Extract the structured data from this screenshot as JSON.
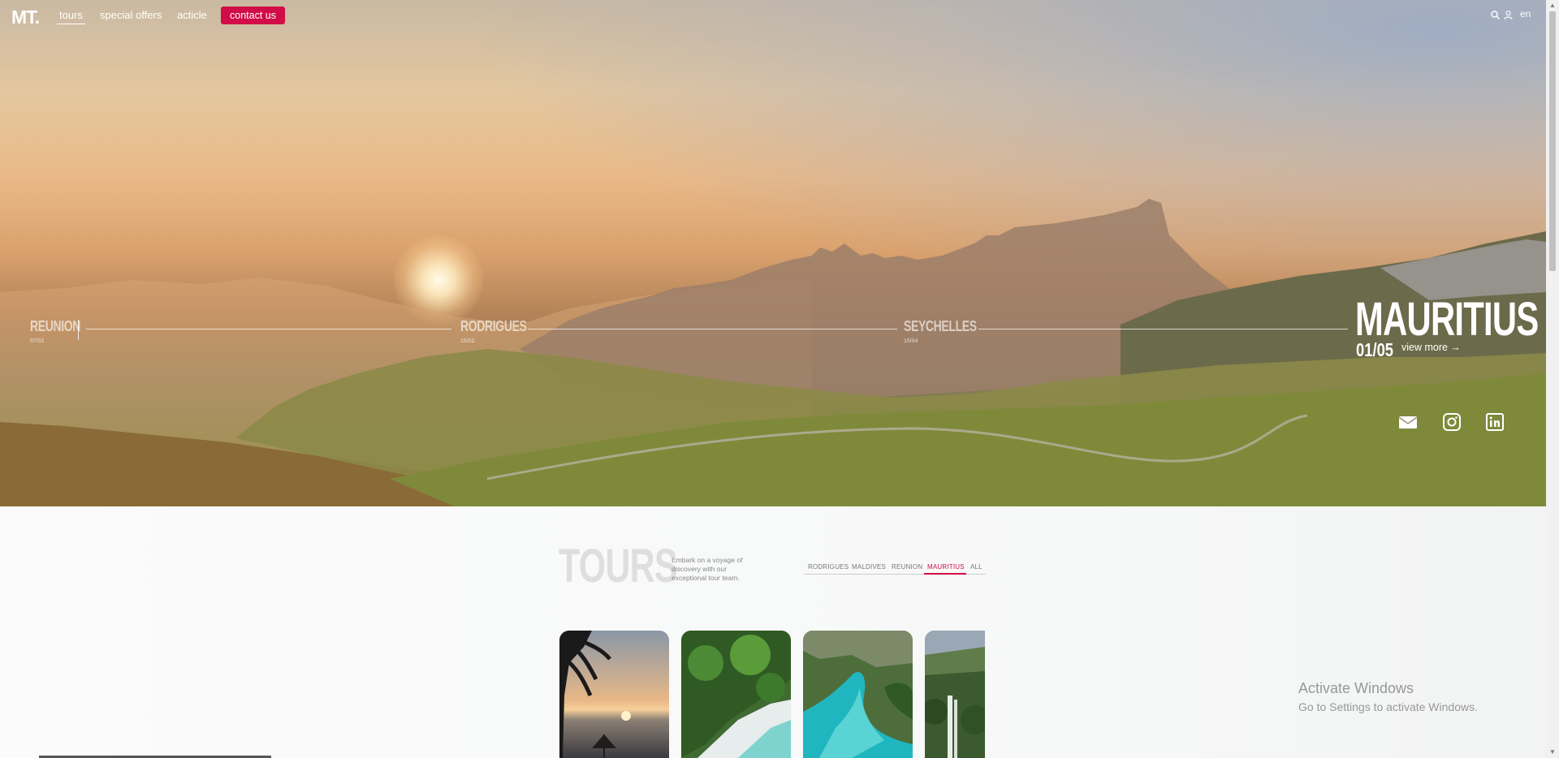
{
  "header": {
    "logo": "MT.",
    "nav": [
      {
        "label": "tours",
        "active": true
      },
      {
        "label": "special offers",
        "active": false
      },
      {
        "label": "acticle",
        "active": false
      }
    ],
    "contact_label": "contact us",
    "lang": "en",
    "icons": [
      "search-icon",
      "user-icon"
    ]
  },
  "hero": {
    "destinations": [
      {
        "name": "REUNION",
        "num": "07/01"
      },
      {
        "name": "RODRIGUES",
        "num": "15/02"
      },
      {
        "name": "SEYCHELLES",
        "num": "15/04"
      }
    ],
    "current": {
      "name": "MAURITIUS",
      "counter": "01/05",
      "view_more": "view more →"
    },
    "social": [
      "mail-icon",
      "instagram-icon",
      "linkedin-icon"
    ]
  },
  "tours": {
    "title": "TOURS",
    "description": "Embark on a voyage of discovery with our exceptional tour team.",
    "filters": [
      {
        "label": "RODRIGUES",
        "active": false
      },
      {
        "label": "MALDIVES",
        "active": false
      },
      {
        "label": "REUNION",
        "active": false
      },
      {
        "label": "MAURITIUS",
        "active": true
      },
      {
        "label": "ALL",
        "active": false
      }
    ],
    "cards": [
      "beach-sunset-image",
      "palm-beach-image",
      "lagoon-aerial-image",
      "waterfall-image"
    ]
  },
  "overlay": {
    "activate_title": "Activate Windows",
    "activate_sub": "Go to Settings to activate Windows."
  },
  "colors": {
    "accent": "#d20c46"
  }
}
